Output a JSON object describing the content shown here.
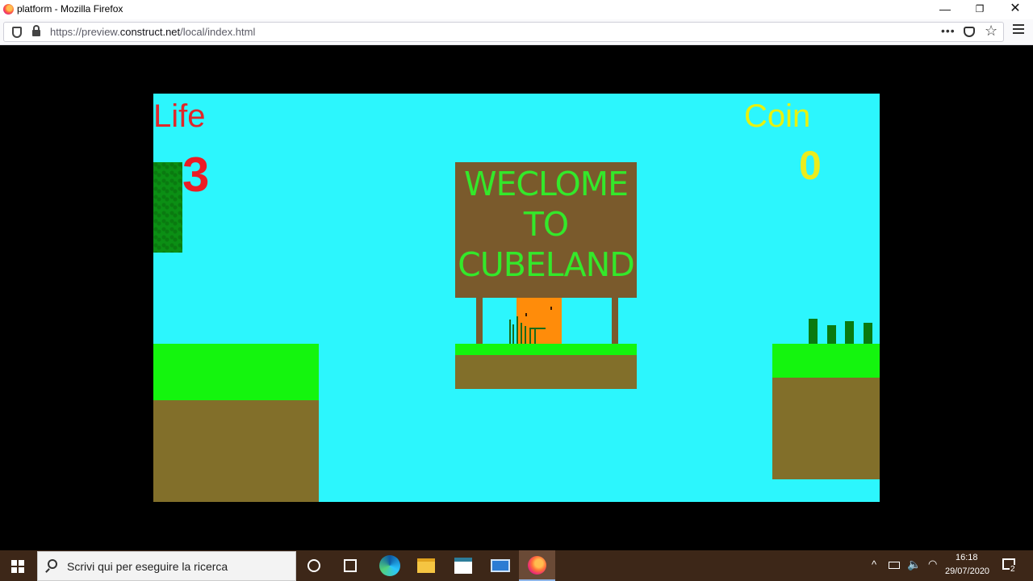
{
  "window": {
    "title": "platform - Mozilla Firefox",
    "minimize_glyph": "—",
    "restore_glyph": "❐",
    "close_glyph": "✕"
  },
  "navbar": {
    "url_prefix": "https://preview.",
    "url_domain": "construct.net",
    "url_path": "/local/index.html",
    "page_actions_glyph": "•••",
    "star_glyph": "☆"
  },
  "game": {
    "life_label": "Life",
    "life_value": "3",
    "coin_label": "Coin",
    "coin_value": "0",
    "sign_lines": [
      "WECLOME",
      "TO",
      "CUBELAND"
    ],
    "colors": {
      "sky": "#2cf6fd",
      "grass": "#14f50e",
      "dirt": "#826f2a",
      "sign": "#7a5a2c",
      "sign_text": "#34e82a",
      "player": "#ff8c0a",
      "life": "#ec1c24",
      "coin": "#ecec1c"
    }
  },
  "taskbar": {
    "search_placeholder": "Scrivi qui per eseguire la ricerca",
    "tray_up_glyph": "^",
    "volume_glyph": "🔈",
    "wifi_glyph": "◠",
    "clock_time": "16:18",
    "clock_date": "29/07/2020",
    "notification_count": "2"
  }
}
